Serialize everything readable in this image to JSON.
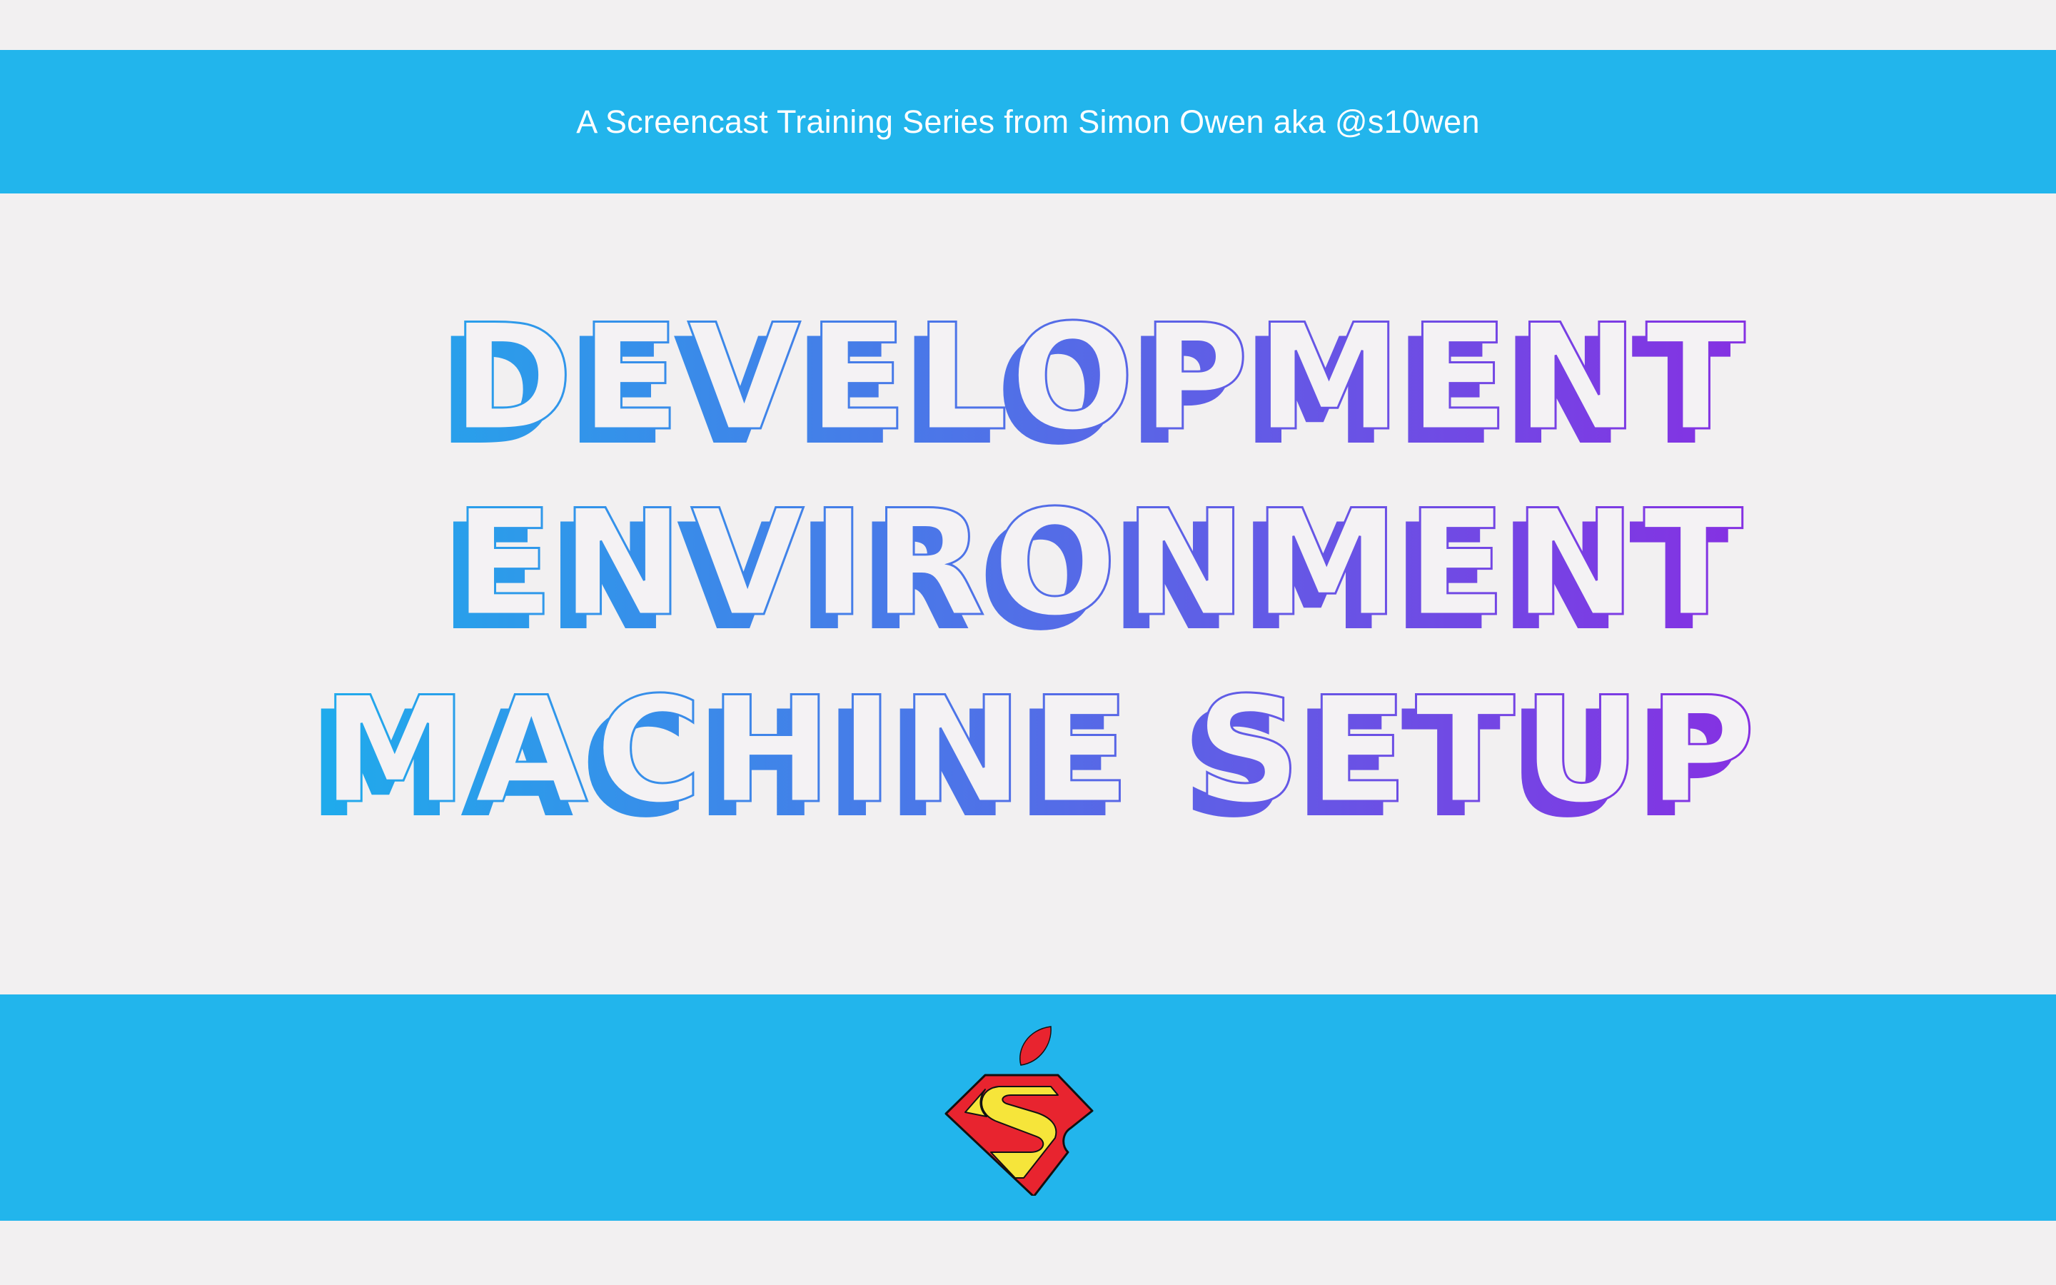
{
  "header": {
    "subtitle": "A Screencast Training Series from Simon Owen aka @s10wen"
  },
  "title": {
    "lines": [
      "DEVELOPMENT",
      "ENVIRONMENT",
      "MACHINE SETUP"
    ],
    "gradient_start": "#1bb0ec",
    "gradient_end": "#8a2be2",
    "face_color": "#f4f2f4"
  },
  "footer": {
    "logo_icon": "superman-apple-logo-icon",
    "logo_colors": {
      "shield": "#e8242f",
      "s_fill": "#f6e53a",
      "leaf": "#e8242f",
      "outline": "#111111"
    }
  },
  "colors": {
    "band": "#22b5ec",
    "background": "#f2f0f1"
  }
}
